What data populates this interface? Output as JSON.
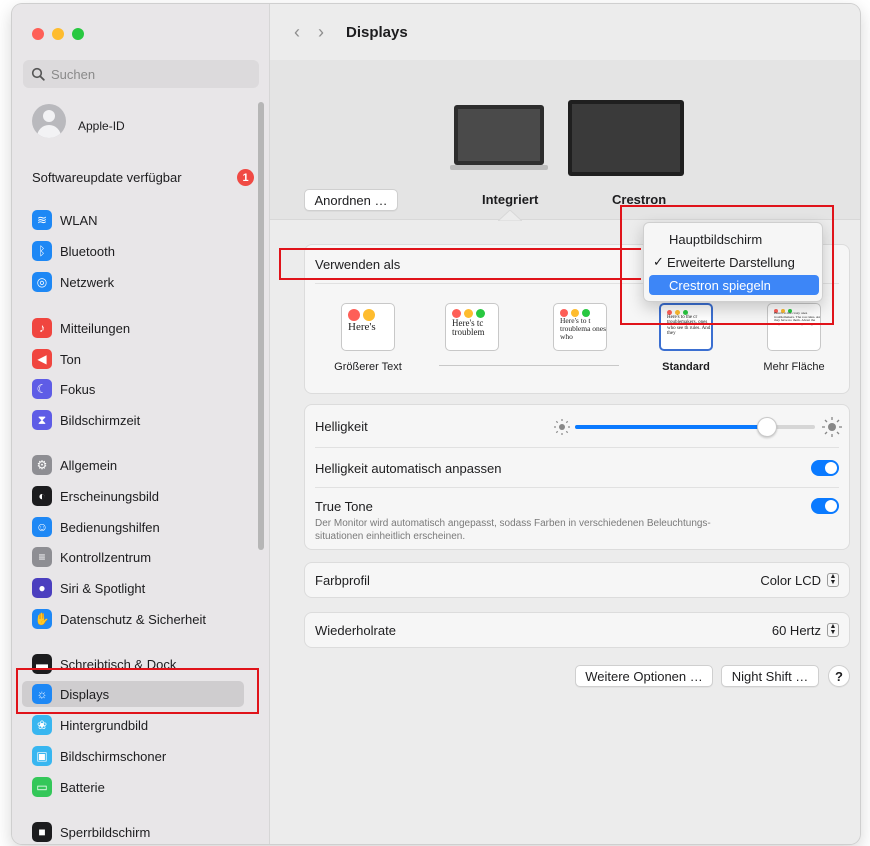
{
  "sidebar": {
    "search_placeholder": "Suchen",
    "apple_id": "Apple-ID",
    "update": {
      "label": "Softwareupdate verfügbar",
      "badge": "1"
    },
    "items": [
      {
        "label": "WLAN",
        "icon": "wifi-icon",
        "color": "#1e88f5"
      },
      {
        "label": "Bluetooth",
        "icon": "bluetooth-icon",
        "color": "#1e88f5"
      },
      {
        "label": "Netzwerk",
        "icon": "globe-icon",
        "color": "#1e88f5"
      },
      {
        "label": "Mitteilungen",
        "icon": "bell-icon",
        "color": "#f0453f"
      },
      {
        "label": "Ton",
        "icon": "speaker-icon",
        "color": "#f0453f"
      },
      {
        "label": "Fokus",
        "icon": "moon-icon",
        "color": "#5e5ce6"
      },
      {
        "label": "Bildschirmzeit",
        "icon": "hourglass-icon",
        "color": "#5e5ce6"
      },
      {
        "label": "Allgemein",
        "icon": "gear-icon",
        "color": "#8e8e93"
      },
      {
        "label": "Erscheinungsbild",
        "icon": "appearance-icon",
        "color": "#1c1c1e"
      },
      {
        "label": "Bedienungshilfen",
        "icon": "accessibility-icon",
        "color": "#1e88f5"
      },
      {
        "label": "Kontrollzentrum",
        "icon": "control-center-icon",
        "color": "#8e8e93"
      },
      {
        "label": "Siri & Spotlight",
        "icon": "siri-icon",
        "color": "#4b3fbf"
      },
      {
        "label": "Datenschutz & Sicherheit",
        "icon": "hand-icon",
        "color": "#1e88f5"
      },
      {
        "label": "Schreibtisch & Dock",
        "icon": "dock-icon",
        "color": "#1c1c1e"
      },
      {
        "label": "Displays",
        "icon": "sun-icon",
        "color": "#1e88f5"
      },
      {
        "label": "Hintergrundbild",
        "icon": "wallpaper-icon",
        "color": "#38b6f0"
      },
      {
        "label": "Bildschirmschoner",
        "icon": "screensaver-icon",
        "color": "#38b6f0"
      },
      {
        "label": "Batterie",
        "icon": "battery-icon",
        "color": "#34c759"
      },
      {
        "label": "Sperrbildschirm",
        "icon": "lock-icon",
        "color": "#1c1c1e"
      }
    ]
  },
  "main": {
    "title": "Displays",
    "back": "‹",
    "forward": "›",
    "arrange_button": "Anordnen …",
    "monitors": [
      {
        "name": "Integriert"
      },
      {
        "name": "Crestron"
      }
    ],
    "use_as_label": "Verwenden als",
    "dropdown": {
      "options": [
        "Hauptbildschirm",
        "Erweiterte Darstellung",
        "Crestron spiegeln"
      ],
      "checked": "Erweiterte Darstellung",
      "highlighted": "Crestron spiegeln",
      "check": "✓"
    },
    "resolutions": [
      {
        "caption": "Größerer Text",
        "sample": "Here's"
      },
      {
        "caption": "",
        "sample": "Here's tc troublem"
      },
      {
        "caption": "",
        "sample": "Here's to t troublema ones who"
      },
      {
        "caption": "Standard",
        "sample": "Here's to the cr troublemakers. ones who see th rules. And they"
      },
      {
        "caption": "Mehr Fläche",
        "sample": "Here's to the crazy ones troublemakers. The rou rules. And they have no them. About the only th Because they change th"
      }
    ],
    "brightness": {
      "label": "Helligkeit",
      "level": 0.8
    },
    "auto_brightness": {
      "label": "Helligkeit automatisch anpassen",
      "on": true
    },
    "true_tone": {
      "label": "True Tone",
      "desc_line1": "Der Monitor wird automatisch angepasst, sodass Farben in verschiedenen Beleuchtungs-",
      "desc_line2": "situationen einheitlich erscheinen.",
      "on": true
    },
    "color_profile": {
      "label": "Farbprofil",
      "value": "Color LCD"
    },
    "refresh_rate": {
      "label": "Wiederholrate",
      "value": "60 Hertz"
    },
    "buttons": {
      "more_options": "Weitere Optionen …",
      "night_shift": "Night Shift …",
      "help": "?"
    }
  },
  "colors": {
    "accent": "#0a7aff",
    "highlight": "#3d86f7",
    "annotation": "#e0131a"
  }
}
